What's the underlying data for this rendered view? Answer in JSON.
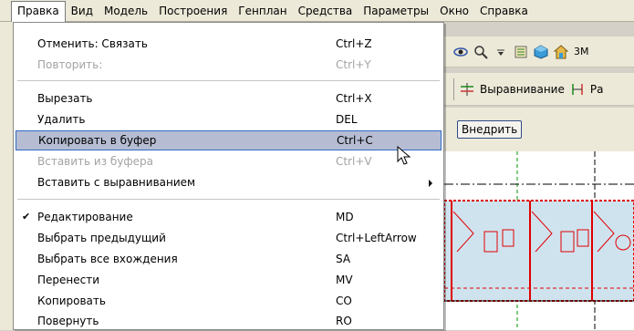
{
  "menubar": {
    "items": [
      "Правка",
      "Вид",
      "Модель",
      "Построения",
      "Генплан",
      "Средства",
      "Параметры",
      "Окно",
      "Справка"
    ]
  },
  "menu": {
    "items": [
      {
        "label": "Отменить: Связать",
        "shortcut": "Ctrl+Z",
        "disabled": false
      },
      {
        "label": "Повторить:",
        "shortcut": "Ctrl+Y",
        "disabled": true
      },
      {
        "label": "Вырезать",
        "shortcut": "Ctrl+X",
        "disabled": false
      },
      {
        "label": "Удалить",
        "shortcut": "DEL",
        "disabled": false
      },
      {
        "label": "Копировать в буфер",
        "shortcut": "Ctrl+C",
        "disabled": false,
        "hover": true
      },
      {
        "label": "Вставить из буфера",
        "shortcut": "Ctrl+V",
        "disabled": true
      },
      {
        "label": "Вставить с выравниванием",
        "shortcut": "",
        "submenu": true
      },
      {
        "label": "Редактирование",
        "shortcut": "MD",
        "checked": true
      },
      {
        "label": "Выбрать предыдущий",
        "shortcut": "Ctrl+LeftArrow"
      },
      {
        "label": "Выбрать все вхождения",
        "shortcut": "SA"
      },
      {
        "label": "Перенести",
        "shortcut": "MV"
      },
      {
        "label": "Копировать",
        "shortcut": "CO"
      },
      {
        "label": "Повернуть",
        "shortcut": "RO"
      }
    ]
  },
  "toolbar": {
    "view3d_label": "3M",
    "align_label": "Выравнивание",
    "align2_label": "Ра",
    "embed_label": "Внедрить"
  },
  "colors": {
    "hover": "#b6bdd2",
    "hover_border": "#316ac5",
    "disabled": "#a3a3a3",
    "drawing_red": "#e00000",
    "drawing_green": "#009900",
    "drawing_fill": "#cfe3ef"
  }
}
